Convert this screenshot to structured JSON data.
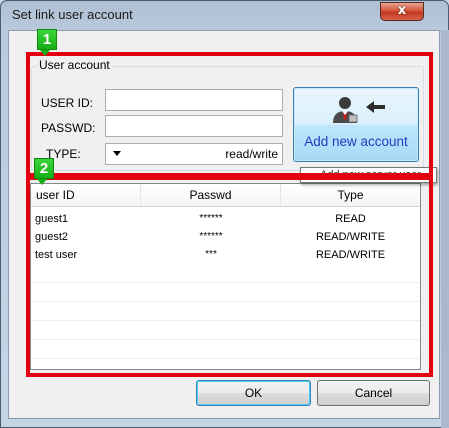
{
  "window": {
    "title": "Set link user account",
    "close_icon": "close-x-icon",
    "close_glyph": "x"
  },
  "user_account": {
    "group_label": "User account",
    "user_id_label": "USER ID:",
    "user_id_value": "",
    "passwd_label": "PASSWD:",
    "passwd_value": "",
    "type_label": "TYPE:",
    "type_selected": "read/write"
  },
  "add_button": {
    "label": "Add new account",
    "icon": "add-user-arrow-icon"
  },
  "tooltip": {
    "text": "Add new server user"
  },
  "list": {
    "columns": [
      "user ID",
      "Passwd",
      "Type"
    ],
    "rows": [
      {
        "user_id": "guest1",
        "passwd": "******",
        "type": "READ"
      },
      {
        "user_id": "guest2",
        "passwd": "******",
        "type": "READ/WRITE"
      },
      {
        "user_id": "test user",
        "passwd": "***",
        "type": "READ/WRITE"
      }
    ]
  },
  "buttons": {
    "ok": "OK",
    "cancel": "Cancel"
  },
  "annotations": {
    "badge_1": "1",
    "badge_2": "2",
    "frame_color": "#e3000f",
    "badge_color": "#16b016"
  }
}
